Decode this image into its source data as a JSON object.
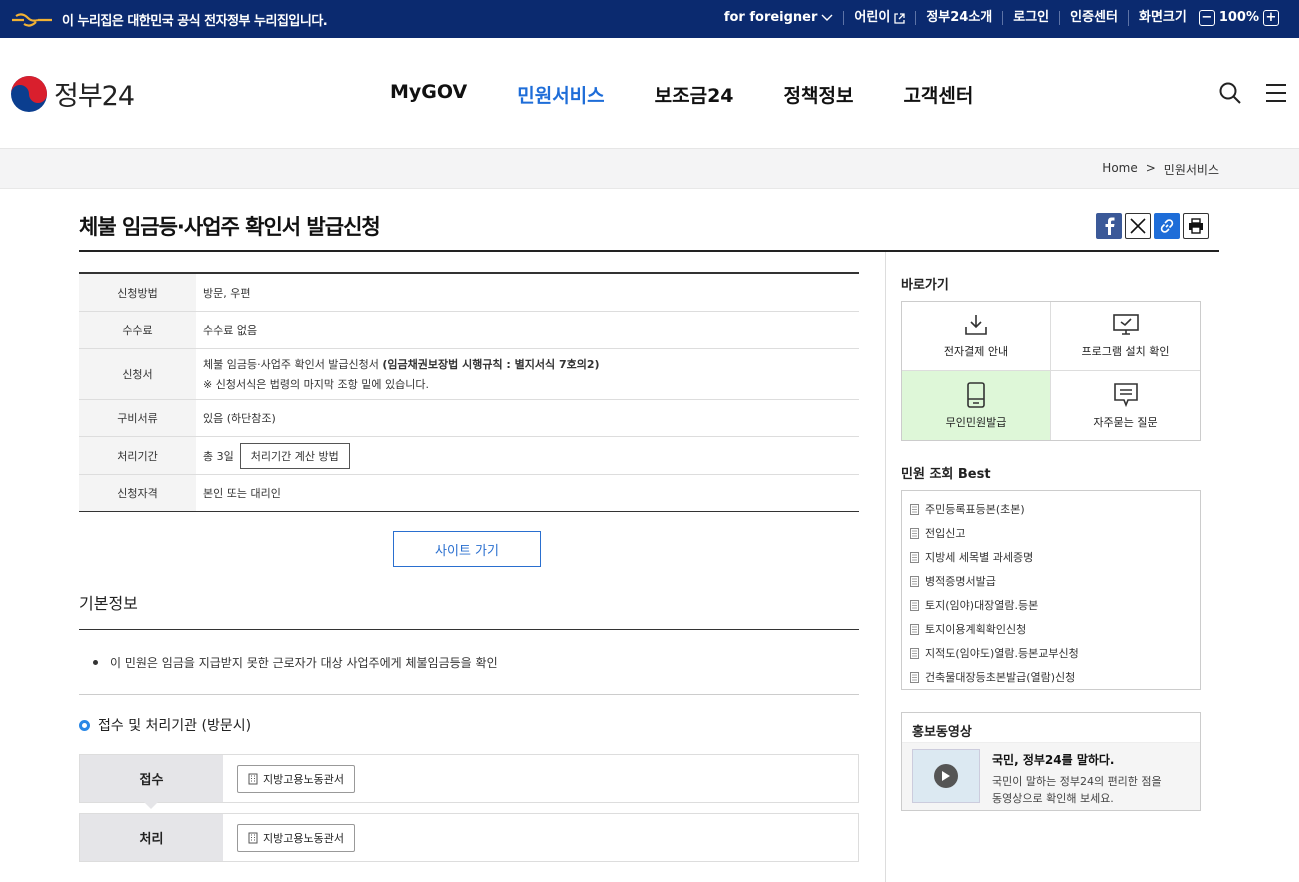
{
  "topbar": {
    "notice": "이 누리집은 대한민국 공식 전자정부 누리집입니다.",
    "links": [
      "for foreigner",
      "어린이",
      "정부24소개",
      "로그인",
      "인증센터"
    ],
    "font_size_label": "화면크기",
    "zoom": "100%",
    "zoom_minus": "−",
    "zoom_plus": "+"
  },
  "header": {
    "logo_text": "정부24",
    "nav": [
      "MyGOV",
      "민원서비스",
      "보조금24",
      "정책정보",
      "고객센터"
    ]
  },
  "breadcrumb": {
    "home": "Home",
    "sep": ">",
    "current": "민원서비스"
  },
  "page": {
    "title": "체불 임금등·사업주 확인서 발급신청",
    "info": [
      {
        "label": "신청방법",
        "value": "방문, 우편"
      },
      {
        "label": "수수료",
        "value": "수수료 없음"
      },
      {
        "label": "신청서",
        "value": "체불 임금등·사업주 확인서 발급신청서",
        "value_bold": "(임금채권보장법 시행규칙 : 별지서식 7호의2)",
        "note": "※ 신청서식은 법령의 마지막 조항 밑에 있습니다."
      },
      {
        "label": "구비서류",
        "value": "있음 (하단참조)"
      },
      {
        "label": "처리기간",
        "value": "총 3일",
        "button": "처리기간 계산 방법"
      },
      {
        "label": "신청자격",
        "value": "본인 또는 대리인"
      }
    ],
    "site_button": "사이트 가기",
    "basic_info_title": "기본정보",
    "basic_info_text": "이 민원은 임금을 지급받지 못한 근로자가 대상 사업주에게 체불임금등을 확인",
    "agency_title": "접수 및 처리기관 (방문시)",
    "receipt_label": "접수",
    "receipt_value": "지방고용노동관서",
    "process_label": "처리",
    "process_value": "지방고용노동관서"
  },
  "sidebar": {
    "quick_title": "바로가기",
    "quick": [
      {
        "label": "전자결제 안내",
        "icon": "download-icon"
      },
      {
        "label": "프로그램 설치 확인",
        "icon": "monitor-check-icon"
      },
      {
        "label": "무인민원발급",
        "icon": "kiosk-icon"
      },
      {
        "label": "자주묻는 질문",
        "icon": "chat-icon"
      }
    ],
    "best_title": "민원 조회 Best",
    "best": [
      "주민등록표등본(초본)",
      "전입신고",
      "지방세 세목별 과세증명",
      "병적증명서발급",
      "토지(임야)대장열람.등본",
      "토지이용계획확인신청",
      "지적도(임야도)열람.등본교부신청",
      "건축물대장등초본발급(열람)신청"
    ],
    "promo_title": "홍보동영상",
    "promo_head": "국민, 정부24를 말하다.",
    "promo_desc1": "국민이 말하는 정부24의 편리한 점을",
    "promo_desc2": "동영상으로 확인해 보세요."
  },
  "colors": {
    "topbar": "#0b2a6f",
    "accent": "#1e6dd8",
    "kiosk_bg": "#def7d8"
  }
}
